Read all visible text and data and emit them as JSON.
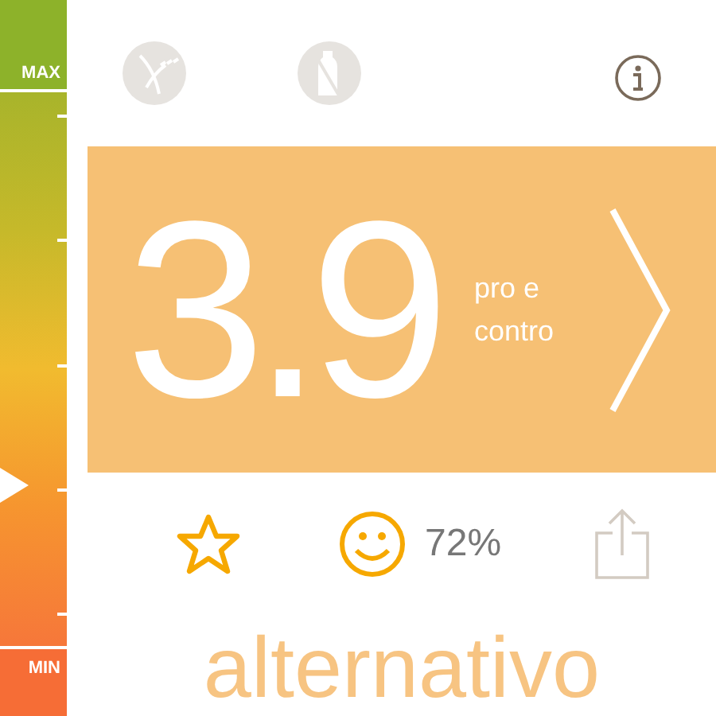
{
  "scale": {
    "max_label": "MAX",
    "min_label": "MIN",
    "level": 0.29
  },
  "score": {
    "value": "3.9",
    "caption": "pro e contro"
  },
  "rating": {
    "percent": "72%"
  },
  "section_title": "alternativo"
}
